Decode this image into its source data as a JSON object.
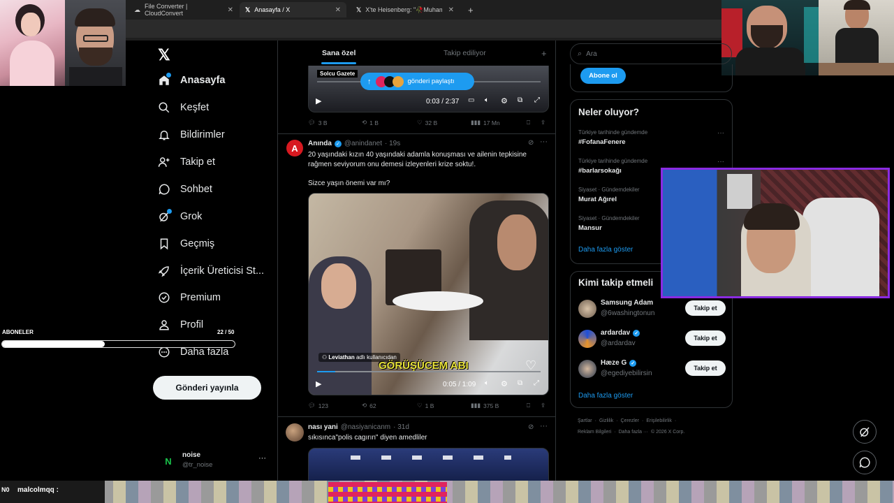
{
  "browser": {
    "tabs": [
      {
        "title": "File Converter | CloudConvert"
      },
      {
        "title": "Anasayfa / X"
      },
      {
        "title": "X'te Heisenberg: \"🥀Muhamme"
      }
    ],
    "new_tab": "+"
  },
  "sidebar": {
    "logo": "𝕏",
    "items": [
      {
        "label": "Anasayfa",
        "icon": "home-icon"
      },
      {
        "label": "Keşfet",
        "icon": "search-icon"
      },
      {
        "label": "Bildirimler",
        "icon": "bell-icon"
      },
      {
        "label": "Takip et",
        "icon": "person-add-icon"
      },
      {
        "label": "Sohbet",
        "icon": "chat-icon"
      },
      {
        "label": "Grok",
        "icon": "grok-icon"
      },
      {
        "label": "Geçmiş",
        "icon": "bookmark-icon"
      },
      {
        "label": "İçerik Üreticisi St...",
        "icon": "rocket-icon"
      },
      {
        "label": "Premium",
        "icon": "verified-icon"
      },
      {
        "label": "Profil",
        "icon": "person-icon"
      },
      {
        "label": "Daha fazla",
        "icon": "more-circle-icon"
      }
    ],
    "post_button": "Gönderi yayınla",
    "account": {
      "name": "noise",
      "handle": "@tr_noise",
      "more": "···"
    }
  },
  "overlay": {
    "subs_label": "ABONELER",
    "subs_count": "22 / 50",
    "subs_progress": 0.44,
    "chat_user": "malcolmqq :"
  },
  "feed": {
    "tabs": [
      "Sana özel",
      "Takip ediliyor"
    ],
    "add_tab": "+",
    "pill": "gönderi paylaştı",
    "post0": {
      "overlay_text": "Solcu Gazete",
      "time": "0:03 / 2:37",
      "stats": {
        "replies": "3 B",
        "reposts": "1 B",
        "likes": "32 B",
        "views": "17 Mn"
      }
    },
    "post1": {
      "avatar_letter": "A",
      "name": "Anında",
      "handle": "@anindanet",
      "age": "· 19s",
      "text1": "20 yaşındaki kızın 40 yaşındaki adamla konuşması ve ailenin tepkisine",
      "text2": "rağmen seviyorum onu demesi izleyenleri krize soktu!.",
      "text3": "Sizce yaşın önemi var mı?",
      "video_credit_name": "Leviathan",
      "video_credit_rest": "adlı kullanıcıdan",
      "video_caption": "GÖRÜŞÜCEM ABI",
      "time": "0:05 / 1:09",
      "stats": {
        "replies": "123",
        "reposts": "62",
        "likes": "1 B",
        "views": "375 B"
      }
    },
    "post2": {
      "name": "nası yani",
      "handle": "@nasiyanicanm",
      "age": "· 31d",
      "text": "sıkısınca\"polis cagırın\" diyen amedliler"
    }
  },
  "right": {
    "search_placeholder": "Ara",
    "subscribe_button": "Abone ol",
    "trends_title": "Neler oluyor?",
    "trends": [
      {
        "meta": "Türkiye tarihinde gündemde",
        "name": "#FofanaFenere"
      },
      {
        "meta": "Türkiye tarihinde gündemde",
        "name": "#barlarsokağı"
      },
      {
        "meta": "Siyaset · Gündemdekiler",
        "name": "Murat Ağırel"
      },
      {
        "meta": "Siyaset · Gündemdekiler",
        "name": "Mansur"
      }
    ],
    "show_more": "Daha fazla göster",
    "who_title": "Kimi takip etmeli",
    "who": [
      {
        "name": "Samsung Adam",
        "handle": "@6washingtonun",
        "verified": false
      },
      {
        "name": "ardardav",
        "handle": "@ardardav",
        "verified": true
      },
      {
        "name": "Hæze G",
        "handle": "@egediyebilirsin",
        "verified": true
      }
    ],
    "follow_label": "Takip et",
    "footer1": [
      "Şartlar",
      "Gizlilik",
      "Çerezler",
      "Erişilebilirlik"
    ],
    "footer2": [
      "Reklam Bilgileri",
      "Daha fazla ···",
      "© 2026 X Corp."
    ]
  },
  "colors": {
    "accent": "#1d9bf0",
    "border": "#2f3336",
    "muted": "#71767b",
    "stream_purple": "#8a2be2"
  }
}
